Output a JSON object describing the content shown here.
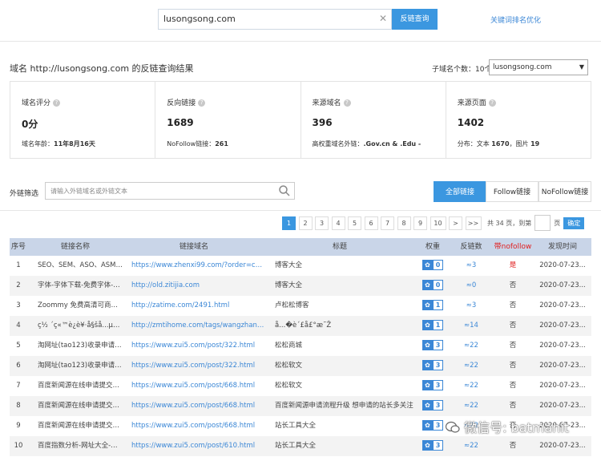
{
  "search": {
    "value": "lusongsong.com",
    "clear_icon": "✕",
    "button": "反链查询",
    "keyword_link": "关键词排名优化"
  },
  "result": {
    "title": "域名 http://lusongsong.com 的反链查询结果",
    "subdomain_count": "子域名个数：10个",
    "subdomain_selected": "lusongsong.com"
  },
  "stats": [
    {
      "label": "域名评分",
      "value": "0分",
      "sub_label": "域名年龄：",
      "sub_value": "11年8月16天"
    },
    {
      "label": "反向链接",
      "value": "1689",
      "sub_label": "NoFollow链接：",
      "sub_value": "261"
    },
    {
      "label": "来源域名",
      "value": "396",
      "sub_label": "高权重域名外链：",
      "sub_value": ".Gov.cn & .Edu -"
    },
    {
      "label": "来源页面",
      "value": "1402",
      "sub_label": "分布：文本 ",
      "sub_value": "1670",
      "sub_label2": "，图片 ",
      "sub_value2": "19"
    }
  ],
  "filter": {
    "label": "外链筛选",
    "placeholder": "请输入外链域名或外链文本",
    "tabs": [
      "全部链接",
      "Follow链接",
      "NoFollow链接"
    ],
    "active_tab": "全部链接"
  },
  "pager": {
    "pages": [
      "1",
      "2",
      "3",
      "4",
      "5",
      "6",
      "7",
      "8",
      "9",
      "10",
      ">",
      ">>"
    ],
    "active": "1",
    "total_text": "共 34 页，到第",
    "page_unit": "页",
    "confirm": "确定"
  },
  "table": {
    "headers": [
      "序号",
      "链接名称",
      "链接域名",
      "标题",
      "权重",
      "反链数",
      "带nofollow",
      "发现时间"
    ],
    "rows": [
      {
        "idx": "1",
        "name": "SEO、SEM、ASO、ASM，...",
        "url": "https://www.zhenxi99.com/?order=comm...",
        "title": "博客大全",
        "weight": "0",
        "out": "≈3",
        "nofollow": "是",
        "time": "2020-07-23..."
      },
      {
        "idx": "2",
        "name": "字体-字体下载-免费字体-字...",
        "url": "http://old.zitijia.com",
        "title": "博客大全",
        "weight": "0",
        "out": "≈0",
        "nofollow": "否",
        "time": "2020-07-23..."
      },
      {
        "idx": "3",
        "name": "Zoommy 免费高清可商用图...",
        "url": "http://zatime.com/2491.html",
        "title": "卢松松博客",
        "weight": "1",
        "out": "≈3",
        "nofollow": "否",
        "time": "2020-07-23..."
      },
      {
        "idx": "4",
        "name": "ç½ ´ç«™è¿è¥·å§šå...µå...",
        "url": "http://zmtihome.com/tags/wangzhanyuny...",
        "title": "å...�è´£å£°æ˜Ž",
        "weight": "1",
        "out": "≈14",
        "nofollow": "否",
        "time": "2020-07-23..."
      },
      {
        "idx": "5",
        "name": "淘网址(tao123)收录申请-网...",
        "url": "https://www.zui5.com/post/322.html",
        "title": "松松商城",
        "weight": "3",
        "out": "≈22",
        "nofollow": "否",
        "time": "2020-07-23..."
      },
      {
        "idx": "6",
        "name": "淘网址(tao123)收录申请-网...",
        "url": "https://www.zui5.com/post/322.html",
        "title": "松松软文",
        "weight": "3",
        "out": "≈22",
        "nofollow": "否",
        "time": "2020-07-23..."
      },
      {
        "idx": "7",
        "name": "百度新闻源在线申请提交入口...",
        "url": "https://www.zui5.com/post/668.html",
        "title": "松松软文",
        "weight": "3",
        "out": "≈22",
        "nofollow": "否",
        "time": "2020-07-23..."
      },
      {
        "idx": "8",
        "name": "百度新闻源在线申请提交入口...",
        "url": "https://www.zui5.com/post/668.html",
        "title": "百度新闻源申请流程升级 想申请的站长多关注",
        "weight": "3",
        "out": "≈22",
        "nofollow": "否",
        "time": "2020-07-23..."
      },
      {
        "idx": "9",
        "name": "百度新闻源在线申请提交入口...",
        "url": "https://www.zui5.com/post/668.html",
        "title": "站长工具大全",
        "weight": "3",
        "out": "≈22",
        "nofollow": "否",
        "time": "2020-07-23..."
      },
      {
        "idx": "10",
        "name": "百度指数分析-网址大全-最我...",
        "url": "https://www.zui5.com/post/610.html",
        "title": "站长工具大全",
        "weight": "3",
        "out": "≈22",
        "nofollow": "否",
        "time": "2020-07-23..."
      }
    ]
  },
  "watermark": "微信号: batmanit",
  "colors": {
    "accent": "#3b97e0",
    "link": "#3b87d6",
    "header_bg": "#c9d5e8",
    "danger": "#e02020"
  }
}
